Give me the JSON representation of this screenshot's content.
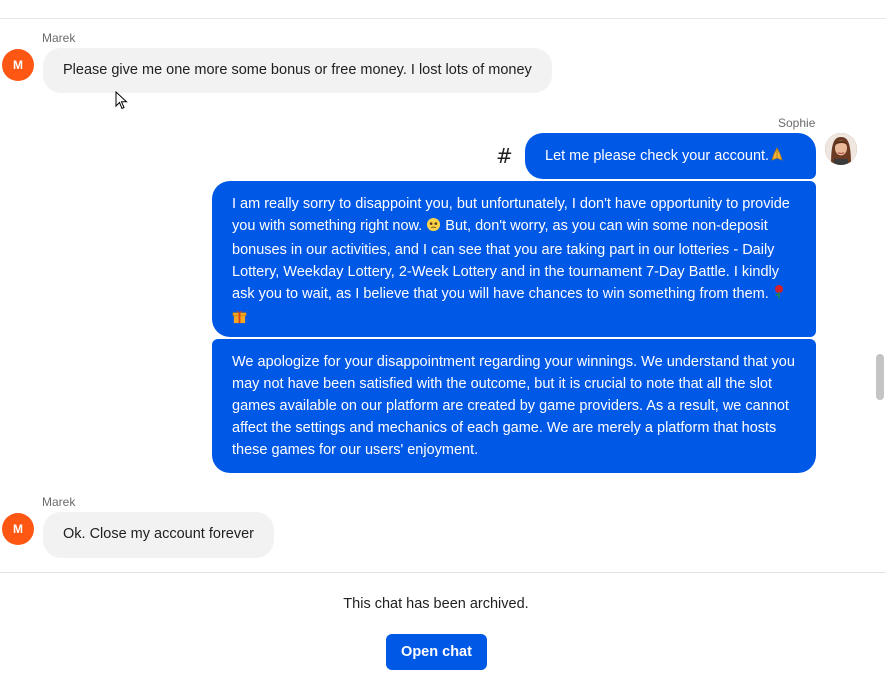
{
  "messages": [
    {
      "sender": "Marek",
      "avatar_initial": "M",
      "text": "Please give me one more some bonus or free money. I lost lots of money"
    },
    {
      "sender": "Sophie",
      "text": "Let me please check your account."
    },
    {
      "text_part1": "I am really sorry to disappoint you, but unfortunately, I don't have opportunity to provide you with something right now.",
      "text_part2": "But, don't worry, as you can win some non-deposit bonuses in our activities, and I can see that you are taking part in our lotteries - Daily Lottery, Weekday Lottery, 2-Week Lottery and in the tournament 7-Day Battle. I kindly ask you to wait, as I believe that you will have chances to win something from them."
    },
    {
      "text": "We apologize for your disappointment regarding your winnings. We understand that you may not have been satisfied with the outcome, but it is crucial to note that all the slot games available on our platform are created by game providers. As a result, we cannot affect the settings and mechanics of each game. We are merely a platform that hosts these games for our users' enjoyment."
    },
    {
      "sender": "Marek",
      "avatar_initial": "M",
      "text": "Ok. Close my account forever"
    }
  ],
  "hash_symbol": "#",
  "footer": {
    "archived_text": "This chat has been archived.",
    "open_chat_label": "Open chat"
  },
  "colors": {
    "agent_bubble": "#0058e6",
    "visitor_bubble": "#f2f2f2",
    "visitor_avatar": "#fe5613"
  },
  "icons": [
    "mouse-cursor-icon",
    "hash-icon",
    "pleading-face-emoji-icon",
    "folded-hands-emoji-icon",
    "rose-emoji-icon",
    "gift-emoji-icon"
  ]
}
